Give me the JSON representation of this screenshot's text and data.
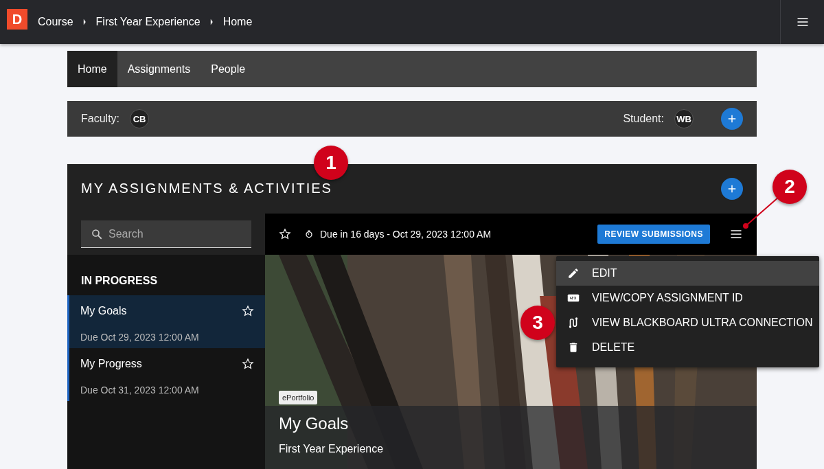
{
  "top_bar": {
    "logo": "D",
    "breadcrumbs": [
      "Course",
      "First Year Experience",
      "Home"
    ]
  },
  "tabs": [
    {
      "label": "Home",
      "selected": true
    },
    {
      "label": "Assignments",
      "selected": false
    },
    {
      "label": "People",
      "selected": false
    }
  ],
  "people_bar": {
    "faculty_label": "Faculty:",
    "faculty_initials": "CB",
    "student_label": "Student:",
    "student_initials": "WB"
  },
  "assignments": {
    "title": "MY ASSIGNMENTS & ACTIVITIES",
    "search": {
      "placeholder": "Search"
    },
    "section": "IN PROGRESS",
    "items": [
      {
        "title": "My Goals",
        "due": "Due Oct 29, 2023 12:00 AM",
        "selected": true
      },
      {
        "title": "My Progress",
        "due": "Due Oct 31, 2023 12:00 AM",
        "selected": false
      }
    ],
    "detail": {
      "due": "Due in 16 days - Oct 29, 2023 12:00 AM",
      "button": "REVIEW SUBMISSIONS",
      "tag": "ePortfolio",
      "title": "My Goals",
      "subtitle": "First Year Experience"
    },
    "menu": [
      {
        "label": "EDIT",
        "kind": "edit",
        "selected": true
      },
      {
        "label": "VIEW/COPY ASSIGNMENT ID",
        "kind": "id",
        "selected": false
      },
      {
        "label": "VIEW BLACKBOARD ULTRA CONNECTION",
        "kind": "connection",
        "selected": false
      },
      {
        "label": "DELETE",
        "kind": "delete",
        "selected": false
      }
    ]
  },
  "callouts": [
    "1",
    "2",
    "3"
  ]
}
